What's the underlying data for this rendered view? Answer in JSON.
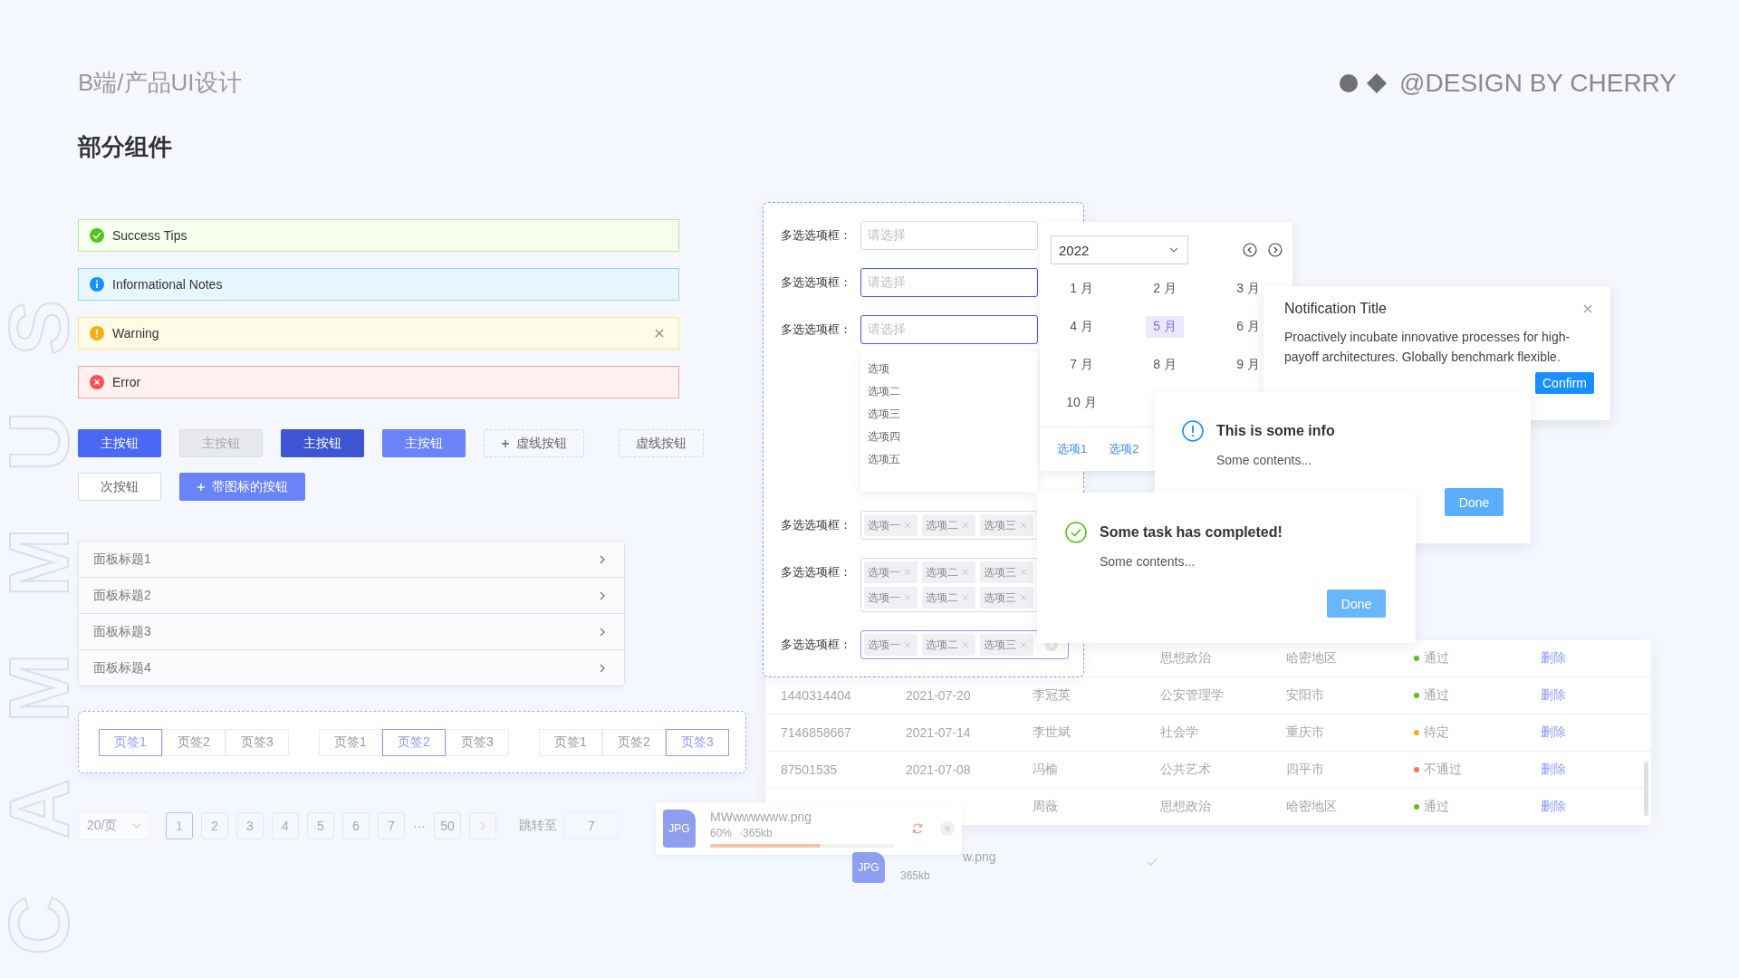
{
  "header": {
    "title": "B端/产品UI设计",
    "brand": "@DESIGN BY CHERRY"
  },
  "side_text": "CAMMUS",
  "section_title": "部分组件",
  "alerts": [
    {
      "kind": "success",
      "text": "Success Tips",
      "closable": false
    },
    {
      "kind": "info",
      "text": "Informational Notes",
      "closable": false
    },
    {
      "kind": "warning",
      "text": "Warning",
      "closable": true
    },
    {
      "kind": "error",
      "text": "Error",
      "closable": false
    }
  ],
  "button_rows": [
    [
      {
        "kind": "primary",
        "label": "主按钮",
        "disabled": false
      },
      {
        "kind": "primary",
        "label": "主按钮",
        "disabled": true
      },
      {
        "kind": "primary-dark",
        "label": "主按钮",
        "disabled": false
      },
      {
        "kind": "primary-light",
        "label": "主按钮",
        "disabled": false
      },
      {
        "kind": "dashed-add",
        "label": "虚线按钮",
        "disabled": false
      },
      {
        "kind": "dashed",
        "label": "虚线按钮",
        "disabled": false
      }
    ],
    [
      {
        "kind": "default",
        "label": "次按钮",
        "disabled": false
      },
      {
        "kind": "primary-light-add",
        "label": "带图标的按钮",
        "disabled": false
      }
    ]
  ],
  "collapse": [
    {
      "title": "面板标题1"
    },
    {
      "title": "面板标题2"
    },
    {
      "title": "面板标题3"
    },
    {
      "title": "面板标题4"
    }
  ],
  "tab_groups": [
    [
      {
        "label": "页签1",
        "selected": true
      },
      {
        "label": "页签2",
        "selected": false
      },
      {
        "label": "页签3",
        "selected": false
      }
    ],
    [
      {
        "label": "页签1",
        "selected": false
      },
      {
        "label": "页签2",
        "selected": true
      },
      {
        "label": "页签3",
        "selected": false
      }
    ],
    [
      {
        "label": "页签1",
        "selected": false
      },
      {
        "label": "页签2",
        "selected": false
      },
      {
        "label": "页签3",
        "selected": true
      }
    ]
  ],
  "pagination": {
    "page_size": "20/页",
    "pages": [
      {
        "label": "1",
        "selected": true
      },
      {
        "label": "2",
        "selected": false
      },
      {
        "label": "3",
        "selected": false
      },
      {
        "label": "4",
        "selected": false
      },
      {
        "label": "5",
        "selected": false
      },
      {
        "label": "6",
        "selected": false
      },
      {
        "label": "7",
        "selected": false
      }
    ],
    "ellipsis": "···",
    "last_page": "50",
    "jump_label": "跳转至",
    "jump_value": "7"
  },
  "table": {
    "rows": [
      {
        "major": "思想政治",
        "region": "哈密地区",
        "status": "通过",
        "color": "#52c41a",
        "action": "删除"
      },
      {
        "id": "1440314404",
        "date": "2021-07-20",
        "name": "李冠英",
        "major": "公安管理学",
        "region": "安阳市",
        "status": "通过",
        "color": "#52c41a",
        "action": "删除"
      },
      {
        "id": "7146858667",
        "date": "2021-07-14",
        "name": "李世斌",
        "major": "社会学",
        "region": "重庆市",
        "status": "待定",
        "color": "#faad14",
        "action": "删除"
      },
      {
        "id": "87501535",
        "date": "2021-07-08",
        "name": "冯榆",
        "major": "公共艺术",
        "region": "四平市",
        "status": "不通过",
        "color": "#ff7a45",
        "action": "删除"
      },
      {
        "name": "周薇",
        "major": "思想政治",
        "region": "哈密地区",
        "status": "通过",
        "color": "#52c41a",
        "action": "删除"
      }
    ]
  },
  "uploads": [
    {
      "kind": "uploading",
      "file_type": "JPG",
      "name": "MWwwwwww.png",
      "percent": "60%",
      "size": "·365kb",
      "level": 0.6
    },
    {
      "kind": "done",
      "file_type": "JPG",
      "name": "w.png",
      "size": "365kb"
    }
  ],
  "form": {
    "rows": [
      {
        "label": "多选选项框：",
        "kind": "empty",
        "placeholder": "请选择",
        "focused": false
      },
      {
        "label": "多选选项框：",
        "kind": "empty",
        "placeholder": "请选择",
        "focused": true
      },
      {
        "label": "多选选项框：",
        "kind": "empty",
        "placeholder": "请选择",
        "focused": true
      },
      {
        "label": "多选选项框：",
        "kind": "tags",
        "tags": [
          "选项一",
          "选项二",
          "选项三"
        ],
        "focused": false,
        "clearable": false
      },
      {
        "label": "多选选项框：",
        "kind": "tags",
        "tags": [
          "选项一",
          "选项二",
          "选项三",
          "选项一",
          "选项二",
          "选项三"
        ],
        "focused": false,
        "clearable": false
      },
      {
        "label": "多选选项框：",
        "kind": "tags",
        "tags": [
          "选项一",
          "选项二",
          "选项三"
        ],
        "focused": true,
        "clearable": true
      }
    ],
    "dropdown": [
      "选项",
      "选项二",
      "选项三",
      "选项四",
      "选项五"
    ]
  },
  "calendar": {
    "year": "2022",
    "months": [
      {
        "label": "1 月",
        "selected": false
      },
      {
        "label": "2 月",
        "selected": false
      },
      {
        "label": "3 月",
        "selected": false
      },
      {
        "label": "4 月",
        "selected": false
      },
      {
        "label": "5 月",
        "selected": true
      },
      {
        "label": "6 月",
        "selected": false
      },
      {
        "label": "7 月",
        "selected": false
      },
      {
        "label": "8 月",
        "selected": false
      },
      {
        "label": "9 月",
        "selected": false
      },
      {
        "label": "10 月",
        "selected": false
      }
    ],
    "footer_links": [
      "选项1",
      "选项2"
    ]
  },
  "notification": {
    "title": "Notification Title",
    "body": "Proactively incubate innovative processes for high-payoff architectures. Globally benchmark flexible.",
    "button": "Confirm"
  },
  "modals": [
    {
      "kind": "info",
      "title": "This is some info",
      "content": "Some contents...",
      "button": "Done"
    },
    {
      "kind": "success",
      "title": "Some task has completed!",
      "content": "Some contents...",
      "button": "Done"
    }
  ]
}
